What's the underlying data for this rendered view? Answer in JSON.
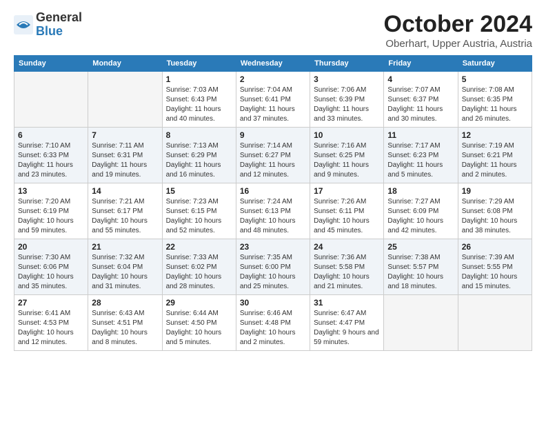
{
  "logo": {
    "general": "General",
    "blue": "Blue"
  },
  "title": "October 2024",
  "location": "Oberhart, Upper Austria, Austria",
  "days_of_week": [
    "Sunday",
    "Monday",
    "Tuesday",
    "Wednesday",
    "Thursday",
    "Friday",
    "Saturday"
  ],
  "weeks": [
    [
      {
        "day": "",
        "info": ""
      },
      {
        "day": "",
        "info": ""
      },
      {
        "day": "1",
        "info": "Sunrise: 7:03 AM\nSunset: 6:43 PM\nDaylight: 11 hours and 40 minutes."
      },
      {
        "day": "2",
        "info": "Sunrise: 7:04 AM\nSunset: 6:41 PM\nDaylight: 11 hours and 37 minutes."
      },
      {
        "day": "3",
        "info": "Sunrise: 7:06 AM\nSunset: 6:39 PM\nDaylight: 11 hours and 33 minutes."
      },
      {
        "day": "4",
        "info": "Sunrise: 7:07 AM\nSunset: 6:37 PM\nDaylight: 11 hours and 30 minutes."
      },
      {
        "day": "5",
        "info": "Sunrise: 7:08 AM\nSunset: 6:35 PM\nDaylight: 11 hours and 26 minutes."
      }
    ],
    [
      {
        "day": "6",
        "info": "Sunrise: 7:10 AM\nSunset: 6:33 PM\nDaylight: 11 hours and 23 minutes."
      },
      {
        "day": "7",
        "info": "Sunrise: 7:11 AM\nSunset: 6:31 PM\nDaylight: 11 hours and 19 minutes."
      },
      {
        "day": "8",
        "info": "Sunrise: 7:13 AM\nSunset: 6:29 PM\nDaylight: 11 hours and 16 minutes."
      },
      {
        "day": "9",
        "info": "Sunrise: 7:14 AM\nSunset: 6:27 PM\nDaylight: 11 hours and 12 minutes."
      },
      {
        "day": "10",
        "info": "Sunrise: 7:16 AM\nSunset: 6:25 PM\nDaylight: 11 hours and 9 minutes."
      },
      {
        "day": "11",
        "info": "Sunrise: 7:17 AM\nSunset: 6:23 PM\nDaylight: 11 hours and 5 minutes."
      },
      {
        "day": "12",
        "info": "Sunrise: 7:19 AM\nSunset: 6:21 PM\nDaylight: 11 hours and 2 minutes."
      }
    ],
    [
      {
        "day": "13",
        "info": "Sunrise: 7:20 AM\nSunset: 6:19 PM\nDaylight: 10 hours and 59 minutes."
      },
      {
        "day": "14",
        "info": "Sunrise: 7:21 AM\nSunset: 6:17 PM\nDaylight: 10 hours and 55 minutes."
      },
      {
        "day": "15",
        "info": "Sunrise: 7:23 AM\nSunset: 6:15 PM\nDaylight: 10 hours and 52 minutes."
      },
      {
        "day": "16",
        "info": "Sunrise: 7:24 AM\nSunset: 6:13 PM\nDaylight: 10 hours and 48 minutes."
      },
      {
        "day": "17",
        "info": "Sunrise: 7:26 AM\nSunset: 6:11 PM\nDaylight: 10 hours and 45 minutes."
      },
      {
        "day": "18",
        "info": "Sunrise: 7:27 AM\nSunset: 6:09 PM\nDaylight: 10 hours and 42 minutes."
      },
      {
        "day": "19",
        "info": "Sunrise: 7:29 AM\nSunset: 6:08 PM\nDaylight: 10 hours and 38 minutes."
      }
    ],
    [
      {
        "day": "20",
        "info": "Sunrise: 7:30 AM\nSunset: 6:06 PM\nDaylight: 10 hours and 35 minutes."
      },
      {
        "day": "21",
        "info": "Sunrise: 7:32 AM\nSunset: 6:04 PM\nDaylight: 10 hours and 31 minutes."
      },
      {
        "day": "22",
        "info": "Sunrise: 7:33 AM\nSunset: 6:02 PM\nDaylight: 10 hours and 28 minutes."
      },
      {
        "day": "23",
        "info": "Sunrise: 7:35 AM\nSunset: 6:00 PM\nDaylight: 10 hours and 25 minutes."
      },
      {
        "day": "24",
        "info": "Sunrise: 7:36 AM\nSunset: 5:58 PM\nDaylight: 10 hours and 21 minutes."
      },
      {
        "day": "25",
        "info": "Sunrise: 7:38 AM\nSunset: 5:57 PM\nDaylight: 10 hours and 18 minutes."
      },
      {
        "day": "26",
        "info": "Sunrise: 7:39 AM\nSunset: 5:55 PM\nDaylight: 10 hours and 15 minutes."
      }
    ],
    [
      {
        "day": "27",
        "info": "Sunrise: 6:41 AM\nSunset: 4:53 PM\nDaylight: 10 hours and 12 minutes."
      },
      {
        "day": "28",
        "info": "Sunrise: 6:43 AM\nSunset: 4:51 PM\nDaylight: 10 hours and 8 minutes."
      },
      {
        "day": "29",
        "info": "Sunrise: 6:44 AM\nSunset: 4:50 PM\nDaylight: 10 hours and 5 minutes."
      },
      {
        "day": "30",
        "info": "Sunrise: 6:46 AM\nSunset: 4:48 PM\nDaylight: 10 hours and 2 minutes."
      },
      {
        "day": "31",
        "info": "Sunrise: 6:47 AM\nSunset: 4:47 PM\nDaylight: 9 hours and 59 minutes."
      },
      {
        "day": "",
        "info": ""
      },
      {
        "day": "",
        "info": ""
      }
    ]
  ]
}
